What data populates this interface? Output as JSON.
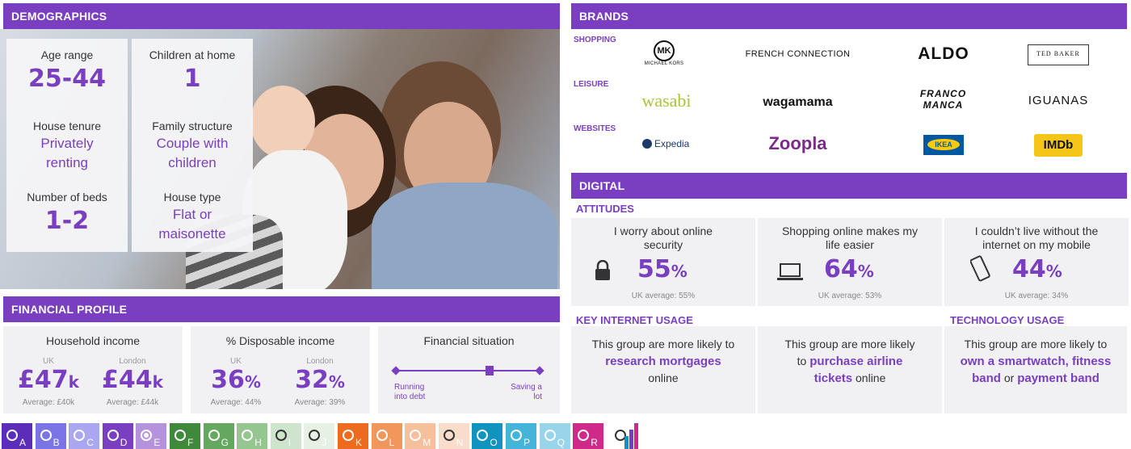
{
  "demographics": {
    "header": "DEMOGRAPHICS",
    "cards": [
      {
        "label": "Age range",
        "value": "25-44"
      },
      {
        "label": "Children at home",
        "value": "1"
      },
      {
        "label": "House tenure",
        "value": "Privately renting"
      },
      {
        "label": "Family structure",
        "value": "Couple with children"
      },
      {
        "label": "Number of beds",
        "value": "1-2"
      },
      {
        "label": "House type",
        "value": "Flat or maisonette"
      }
    ]
  },
  "financial": {
    "header": "FINANCIAL PROFILE",
    "income": {
      "title": "Household income",
      "uk_label": "UK",
      "uk_value": "£47",
      "uk_unit": "k",
      "uk_avg": "Average: £40k",
      "london_label": "London",
      "london_value": "£44",
      "london_unit": "k",
      "london_avg": "Average: £44k"
    },
    "disposable": {
      "title": "% Disposable income",
      "uk_label": "UK",
      "uk_value": "36",
      "uk_unit": "%",
      "uk_avg": "Average: 44%",
      "london_label": "London",
      "london_value": "32",
      "london_unit": "%",
      "london_avg": "Average: 39%"
    },
    "situation": {
      "title": "Financial situation",
      "left_label": "Running into debt",
      "right_label": "Saving a lot",
      "position": 0.65
    }
  },
  "brands": {
    "header": "BRANDS",
    "rows": [
      {
        "label": "SHOPPING",
        "logos": [
          "MICHAEL KORS",
          "FRENCH CONNECTION",
          "ALDO",
          "TED BAKER"
        ]
      },
      {
        "label": "LEISURE",
        "logos": [
          "wasabi",
          "wagamama",
          "FRANCO MANCA",
          "IGUANAS"
        ]
      },
      {
        "label": "WEBSITES",
        "logos": [
          "Expedia",
          "Zoopla",
          "IKEA",
          "IMDb"
        ]
      }
    ]
  },
  "digital": {
    "header": "DIGITAL",
    "attitudes_label": "ATTITUDES",
    "attitudes": [
      {
        "question": "I worry about online security",
        "value": "55",
        "unit": "%",
        "avg": "UK average: 55%",
        "icon": "lock-icon"
      },
      {
        "question": "Shopping online makes my life easier",
        "value": "64",
        "unit": "%",
        "avg": "UK average: 53%",
        "icon": "laptop-icon"
      },
      {
        "question": "I couldn’t live without the internet on my mobile",
        "value": "44",
        "unit": "%",
        "avg": "UK average: 34%",
        "icon": "mobile-icon"
      }
    ],
    "key_usage_label": "KEY INTERNET USAGE",
    "tech_usage_label": "TECHNOLOGY USAGE",
    "usage": [
      {
        "pre": "This group are more likely to",
        "hl": "research mortgages",
        "post": "online"
      },
      {
        "pre": "This group are more likely to",
        "hl": "purchase airline tickets",
        "post": "online"
      },
      {
        "pre": "This group are more likely to",
        "hl": "own a smartwatch, fitness band",
        "mid": "or",
        "hl2": "payment band"
      }
    ]
  },
  "swatches": {
    "items": [
      {
        "letter": "A",
        "color": "#5b2db8"
      },
      {
        "letter": "B",
        "color": "#7b74e6"
      },
      {
        "letter": "C",
        "color": "#a9a7f0"
      },
      {
        "letter": "D",
        "color": "#7a3fc0"
      },
      {
        "letter": "E",
        "color": "#b592dc"
      },
      {
        "letter": "F",
        "color": "#3f8a3a"
      },
      {
        "letter": "G",
        "color": "#63a85e"
      },
      {
        "letter": "H",
        "color": "#95c690"
      },
      {
        "letter": "I",
        "color": "#cfe4cc"
      },
      {
        "letter": "J",
        "color": "#e6f1e4"
      },
      {
        "letter": "K",
        "color": "#ec6b1f"
      },
      {
        "letter": "L",
        "color": "#f2975c"
      },
      {
        "letter": "M",
        "color": "#f7c09c"
      },
      {
        "letter": "N",
        "color": "#fadccb"
      },
      {
        "letter": "O",
        "color": "#1193c0"
      },
      {
        "letter": "P",
        "color": "#45b4da"
      },
      {
        "letter": "Q",
        "color": "#98d4ea"
      },
      {
        "letter": "R",
        "color": "#cf2a8a"
      }
    ],
    "selected": "E"
  }
}
